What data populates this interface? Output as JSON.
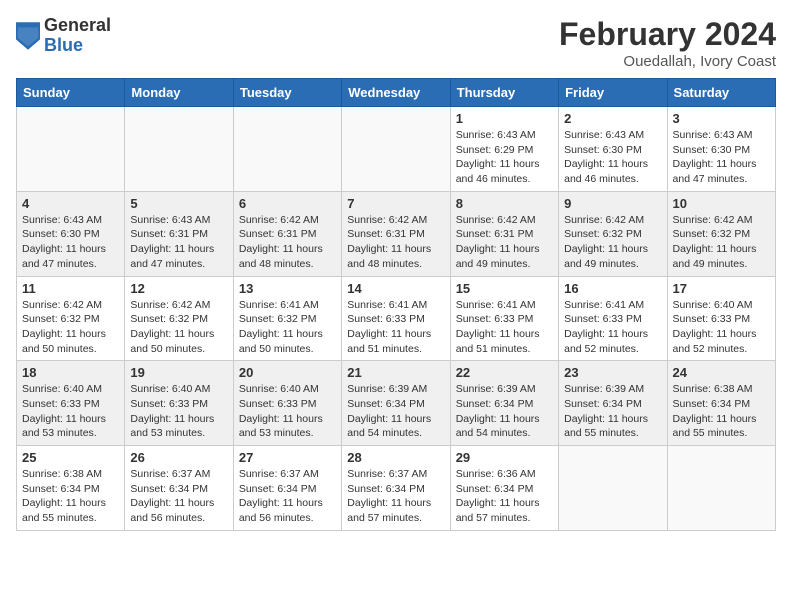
{
  "header": {
    "logo_general": "General",
    "logo_blue": "Blue",
    "month_title": "February 2024",
    "location": "Ouedallah, Ivory Coast"
  },
  "calendar": {
    "days_of_week": [
      "Sunday",
      "Monday",
      "Tuesday",
      "Wednesday",
      "Thursday",
      "Friday",
      "Saturday"
    ],
    "weeks": [
      [
        {
          "day": "",
          "info": ""
        },
        {
          "day": "",
          "info": ""
        },
        {
          "day": "",
          "info": ""
        },
        {
          "day": "",
          "info": ""
        },
        {
          "day": "1",
          "info": "Sunrise: 6:43 AM\nSunset: 6:29 PM\nDaylight: 11 hours and 46 minutes."
        },
        {
          "day": "2",
          "info": "Sunrise: 6:43 AM\nSunset: 6:30 PM\nDaylight: 11 hours and 46 minutes."
        },
        {
          "day": "3",
          "info": "Sunrise: 6:43 AM\nSunset: 6:30 PM\nDaylight: 11 hours and 47 minutes."
        }
      ],
      [
        {
          "day": "4",
          "info": "Sunrise: 6:43 AM\nSunset: 6:30 PM\nDaylight: 11 hours and 47 minutes."
        },
        {
          "day": "5",
          "info": "Sunrise: 6:43 AM\nSunset: 6:31 PM\nDaylight: 11 hours and 47 minutes."
        },
        {
          "day": "6",
          "info": "Sunrise: 6:42 AM\nSunset: 6:31 PM\nDaylight: 11 hours and 48 minutes."
        },
        {
          "day": "7",
          "info": "Sunrise: 6:42 AM\nSunset: 6:31 PM\nDaylight: 11 hours and 48 minutes."
        },
        {
          "day": "8",
          "info": "Sunrise: 6:42 AM\nSunset: 6:31 PM\nDaylight: 11 hours and 49 minutes."
        },
        {
          "day": "9",
          "info": "Sunrise: 6:42 AM\nSunset: 6:32 PM\nDaylight: 11 hours and 49 minutes."
        },
        {
          "day": "10",
          "info": "Sunrise: 6:42 AM\nSunset: 6:32 PM\nDaylight: 11 hours and 49 minutes."
        }
      ],
      [
        {
          "day": "11",
          "info": "Sunrise: 6:42 AM\nSunset: 6:32 PM\nDaylight: 11 hours and 50 minutes."
        },
        {
          "day": "12",
          "info": "Sunrise: 6:42 AM\nSunset: 6:32 PM\nDaylight: 11 hours and 50 minutes."
        },
        {
          "day": "13",
          "info": "Sunrise: 6:41 AM\nSunset: 6:32 PM\nDaylight: 11 hours and 50 minutes."
        },
        {
          "day": "14",
          "info": "Sunrise: 6:41 AM\nSunset: 6:33 PM\nDaylight: 11 hours and 51 minutes."
        },
        {
          "day": "15",
          "info": "Sunrise: 6:41 AM\nSunset: 6:33 PM\nDaylight: 11 hours and 51 minutes."
        },
        {
          "day": "16",
          "info": "Sunrise: 6:41 AM\nSunset: 6:33 PM\nDaylight: 11 hours and 52 minutes."
        },
        {
          "day": "17",
          "info": "Sunrise: 6:40 AM\nSunset: 6:33 PM\nDaylight: 11 hours and 52 minutes."
        }
      ],
      [
        {
          "day": "18",
          "info": "Sunrise: 6:40 AM\nSunset: 6:33 PM\nDaylight: 11 hours and 53 minutes."
        },
        {
          "day": "19",
          "info": "Sunrise: 6:40 AM\nSunset: 6:33 PM\nDaylight: 11 hours and 53 minutes."
        },
        {
          "day": "20",
          "info": "Sunrise: 6:40 AM\nSunset: 6:33 PM\nDaylight: 11 hours and 53 minutes."
        },
        {
          "day": "21",
          "info": "Sunrise: 6:39 AM\nSunset: 6:34 PM\nDaylight: 11 hours and 54 minutes."
        },
        {
          "day": "22",
          "info": "Sunrise: 6:39 AM\nSunset: 6:34 PM\nDaylight: 11 hours and 54 minutes."
        },
        {
          "day": "23",
          "info": "Sunrise: 6:39 AM\nSunset: 6:34 PM\nDaylight: 11 hours and 55 minutes."
        },
        {
          "day": "24",
          "info": "Sunrise: 6:38 AM\nSunset: 6:34 PM\nDaylight: 11 hours and 55 minutes."
        }
      ],
      [
        {
          "day": "25",
          "info": "Sunrise: 6:38 AM\nSunset: 6:34 PM\nDaylight: 11 hours and 55 minutes."
        },
        {
          "day": "26",
          "info": "Sunrise: 6:37 AM\nSunset: 6:34 PM\nDaylight: 11 hours and 56 minutes."
        },
        {
          "day": "27",
          "info": "Sunrise: 6:37 AM\nSunset: 6:34 PM\nDaylight: 11 hours and 56 minutes."
        },
        {
          "day": "28",
          "info": "Sunrise: 6:37 AM\nSunset: 6:34 PM\nDaylight: 11 hours and 57 minutes."
        },
        {
          "day": "29",
          "info": "Sunrise: 6:36 AM\nSunset: 6:34 PM\nDaylight: 11 hours and 57 minutes."
        },
        {
          "day": "",
          "info": ""
        },
        {
          "day": "",
          "info": ""
        }
      ]
    ]
  }
}
